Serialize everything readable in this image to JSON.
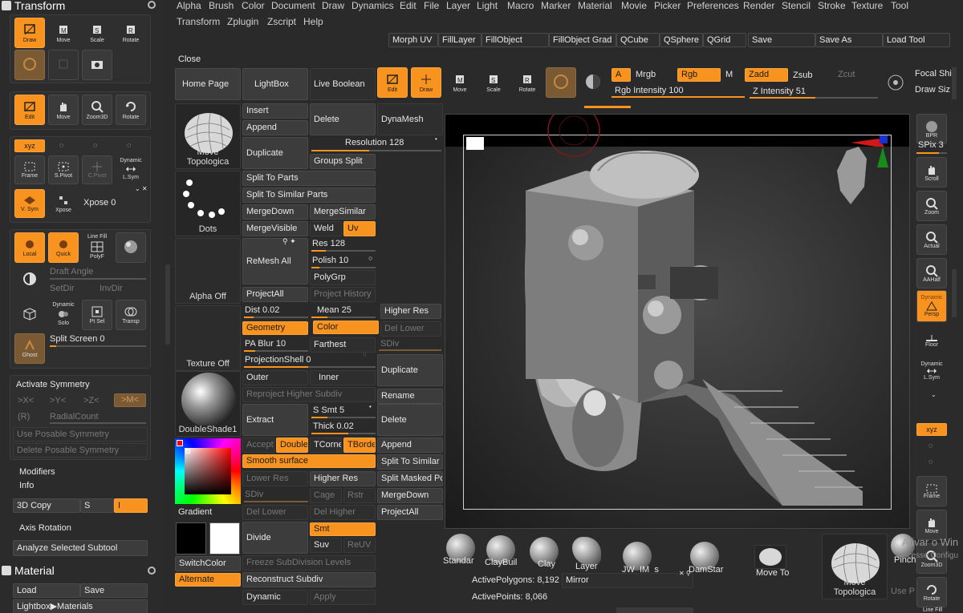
{
  "left": {
    "title": "Transform",
    "tools1": [
      {
        "label": "Draw",
        "icon": "draw-icon",
        "on": true
      },
      {
        "label": "Move",
        "icon": "move-icon"
      },
      {
        "label": "Scale",
        "icon": "scale-icon"
      },
      {
        "label": "Rotate",
        "icon": "rotate-icon"
      }
    ],
    "tools2": [
      {
        "label": "Edit",
        "icon": "edit-icon",
        "on": true
      },
      {
        "label": "Move",
        "icon": "move-hand-icon"
      },
      {
        "label": "Zoom3D",
        "icon": "zoom3d-icon"
      },
      {
        "label": "Rotate",
        "icon": "rotate3d-icon"
      }
    ],
    "xyz_label": "xyz",
    "frame_label": "Frame",
    "spivot_label": "S.Pivot",
    "cpivot_label": "C.Pivot",
    "dynamic_label": "Dynamic",
    "lsym_label": "L.Sym",
    "vsym_label": "V. Sym",
    "xpose_label": "Xpose",
    "xpose_value": "Xpose 0",
    "local_label": "Local",
    "quick_label": "Quick",
    "linefill_label": "Line Fill",
    "polyf_label": "PolyF",
    "draft_angle": "Draft Angle",
    "setdir": "SetDir",
    "invdir": "InvDir",
    "solo_dynamic": "Dynamic",
    "solo_label": "Solo",
    "ptsel_label": "Pt Sel",
    "transp_label": "Transp",
    "ghost_label": "Ghost",
    "split_screen": "Split Screen 0",
    "activate_symmetry": "Activate Symmetry",
    "axes": [
      ">X<",
      ">Y<",
      ">Z<",
      ">M<"
    ],
    "r_label": "(R)",
    "radialcount": "RadialCount",
    "use_posable": "Use Posable Symmetry",
    "delete_posable": "Delete Posable Symmetry",
    "modifiers": "Modifiers",
    "info": "Info",
    "copy3d": "3D Copy",
    "s_label": "S",
    "i_label": "I",
    "axis_rotation": "Axis Rotation",
    "analyze": "Analyze Selected Subtool",
    "material_title": "Material",
    "load": "Load",
    "save": "Save",
    "lightbox_materials": "Lightbox▶Materials"
  },
  "menu": [
    "Alpha",
    "Brush",
    "Color",
    "Document",
    "Draw",
    "Dynamics",
    "Edit",
    "File",
    "Layer",
    "Light",
    "Macro",
    "Marker",
    "Material",
    "Movie",
    "Picker",
    "Preferences",
    "Render",
    "Stencil",
    "Stroke",
    "Texture",
    "Tool",
    "Transform",
    "Zplugin",
    "Zscript",
    "Help"
  ],
  "topbar": [
    "Morph UV",
    "FillLayer",
    "FillObject",
    "FillObject Grad",
    "QCube",
    "QSphere",
    "QGrid",
    "Save",
    "Save As",
    "Load Tool"
  ],
  "close": "Close",
  "palette": {
    "home": "Home Page",
    "lightbox": "LightBox",
    "live_boolean": "Live Boolean",
    "insert": "Insert",
    "append": "Append",
    "delete": "Delete",
    "duplicate": "Duplicate",
    "dynamesh": "DynaMesh",
    "resolution": "Resolution 128",
    "groups_split": "Groups Split",
    "split_to_parts": "Split To Parts",
    "split_similar": "Split To Similar Parts",
    "mergedown": "MergeDown",
    "mergesimilar": "MergeSimilar",
    "mergevisible": "MergeVisible",
    "weld": "Weld",
    "uv": "Uv",
    "remesh_all": "ReMesh All",
    "res": "Res 128",
    "polish": "Polish 10",
    "polygrp": "PolyGrp",
    "projectall": "ProjectAll",
    "project_history": "Project History",
    "dist": "Dist 0.02",
    "mean": "Mean 25",
    "higher_res": "Higher Res",
    "geometry": "Geometry",
    "color": "Color",
    "del_lower": "Del Lower",
    "pa_blur": "PA Blur 10",
    "farthest": "Farthest",
    "sdiv": "SDiv",
    "projection_shell": "ProjectionShell 0",
    "outer": "Outer",
    "inner": "Inner",
    "duplicate2": "Duplicate",
    "reproject": "Reproject Higher Subdiv",
    "rename": "Rename",
    "extract": "Extract",
    "s_smt": "S Smt 5",
    "thick": "Thick 0.02",
    "delete2": "Delete",
    "accept": "Accept",
    "double": "Double",
    "tcorne": "TCorner",
    "tborde": "TBorder",
    "append2": "Append",
    "smooth_surface": "Smooth surface",
    "split_similar2": "Split To Similar Parts",
    "lower_res": "Lower Res",
    "higher_res2": "Higher Res",
    "split_masked": "Split Masked Points",
    "sdiv2": "SDiv",
    "cage": "Cage",
    "rstr": "Rstr",
    "mergedown2": "MergeDown",
    "del_lower2": "Del Lower",
    "del_higher": "Del Higher",
    "projectall2": "ProjectAll",
    "divide": "Divide",
    "smt": "Smt",
    "suv": "Suv",
    "reuv": "ReUV",
    "freeze": "Freeze SubDivision Levels",
    "reconstruct": "Reconstruct Subdiv",
    "dynamic": "Dynamic",
    "apply": "Apply"
  },
  "thumbs": {
    "move_topo": "Move Topologica",
    "dots": "Dots",
    "alpha_off": "Alpha Off",
    "texture_off": "Texture Off",
    "doubleshade": "DoubleShade1",
    "gradient": "Gradient",
    "switchcolor": "SwitchColor",
    "alternate": "Alternate"
  },
  "toolbar": {
    "edit": "Edit",
    "draw": "Draw",
    "move": "Move",
    "scale": "Scale",
    "rotate": "Rotate",
    "a": "A",
    "mrgb": "Mrgb",
    "rgb": "Rgb",
    "m": "M",
    "zadd": "Zadd",
    "zsub": "Zsub",
    "zcut": "Zcut",
    "rgb_intensity": "Rgb Intensity 100",
    "z_intensity": "Z Intensity 51",
    "focal_shift": "Focal Shi",
    "draw_size": "Draw Siz"
  },
  "right": {
    "bpr": "BPR",
    "spix": "SPix 3",
    "scroll": "Scroll",
    "zoom": "Zoom",
    "actual": "Actual",
    "aahalf": "AAHalf",
    "dynamic": "Dynamic",
    "persp": "Persp",
    "floor": "Floor",
    "dynamic2": "Dynamic",
    "lsym": "L.Sym",
    "xyz": "xyz",
    "frame": "Frame",
    "move": "Move",
    "zoom3d": "Zoom3D",
    "rotate": "Rotate",
    "linefill": "Line Fill"
  },
  "bottom": {
    "brushes": [
      "Standar",
      "ClayBuil",
      "Clay",
      "Layer",
      "JW_IM_s",
      "DamStar",
      "Move To",
      "Pinch"
    ],
    "active_polygons": "ActivePolygons: 8,192",
    "active_points": "ActivePoints: 8,066",
    "mirror": "Mirror",
    "move_topo": "Move Topologica",
    "use_p": "Use P",
    "watermark1": "Ativar o Win",
    "watermark2": "Acesse Configu"
  },
  "colors": {
    "accent": "#f7931e",
    "bg": "#2a2a2a",
    "panel": "#2f2f2f",
    "button": "#3c3c3c"
  }
}
